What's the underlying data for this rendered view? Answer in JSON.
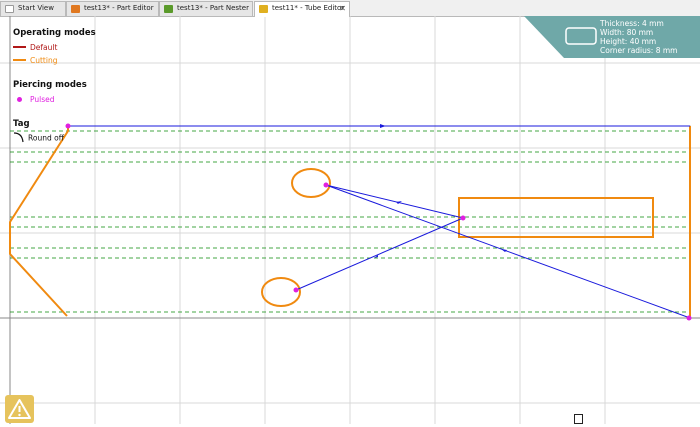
{
  "tabs": [
    {
      "label": "Start View",
      "icon": "start-view-icon",
      "icon_color": "#c0c0c0",
      "active": false
    },
    {
      "label": "test13* - Part Editor",
      "icon": "part-editor-icon",
      "icon_color": "#e07820",
      "active": false
    },
    {
      "label": "test13* - Part Nester",
      "icon": "part-nester-icon",
      "icon_color": "#5a9a2a",
      "active": false
    },
    {
      "label": "test11* - Tube Editor",
      "icon": "tube-editor-icon",
      "icon_color": "#e0b020",
      "active": true,
      "close": "✕"
    }
  ],
  "legend": {
    "operating_title": "Operating modes",
    "default_label": "Default",
    "cutting_label": "Cutting",
    "piercing_title": "Piercing modes",
    "pulsed_label": "Pulsed",
    "tag_title": "Tag",
    "round_off_label": "Round off"
  },
  "info": {
    "thickness": "Thickness: 4 mm",
    "width": "Width: 80 mm",
    "height": "Height: 40 mm",
    "corner_radius": "Corner radius: 8 mm"
  },
  "colors": {
    "default": "#b01818",
    "cutting": "#f08a10",
    "pulsed": "#e020e0",
    "traverse": "#1a1adc",
    "bend_line": "#0a8a0a",
    "panel": "#6fa8a8",
    "grid": "#d9d9d9",
    "tab_bar": "#f0f0f0"
  }
}
